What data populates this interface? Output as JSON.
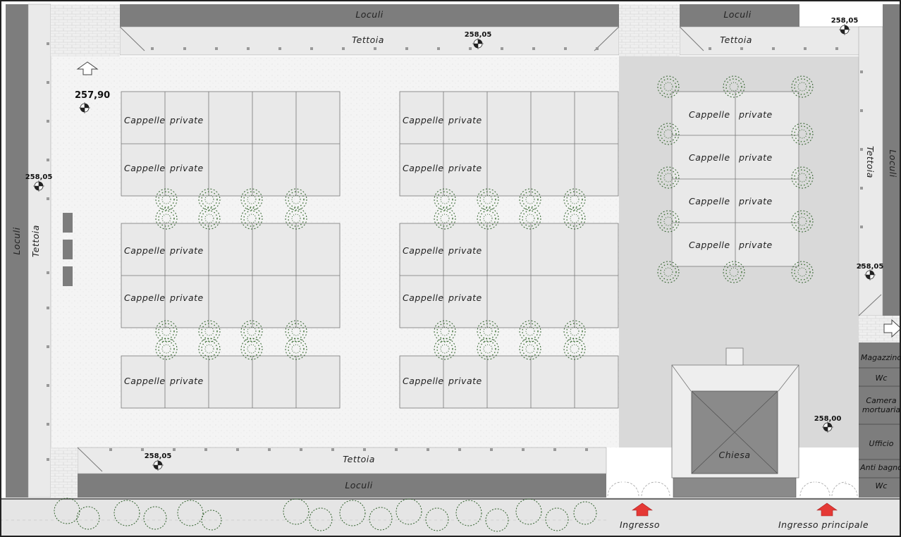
{
  "labels": {
    "loculi": "Loculi",
    "tettoia": "Tettoia",
    "cappelle_private_a": "Cappelle",
    "cappelle_private_b": "private",
    "chiesa": "Chiesa",
    "ingresso": "Ingresso",
    "ingresso_principale": "Ingresso principale"
  },
  "rooms": [
    "Magazzino",
    "Wc",
    "Camera",
    "mortuaria",
    "Ufficio",
    "Anti bagno",
    "Wc"
  ],
  "elevations": {
    "top_center": "258,05",
    "top_right": "258,05",
    "top_left": "257,90",
    "left": "258,05",
    "right": "258,05",
    "lower_right": "258,00",
    "bottom_left": "258,05"
  },
  "icons": [
    "entrance-arrow-icon",
    "north-arrow-icon",
    "tree-icon",
    "benchmark-icon"
  ],
  "colors": {
    "dark_wall": "#7d7d7d",
    "courtyard": "#f3f3f3",
    "plaza": "#d9d9d9",
    "chapel_fill": "#e9e9e9",
    "tree": "#2f5f2a",
    "arrow": "#e53935"
  }
}
